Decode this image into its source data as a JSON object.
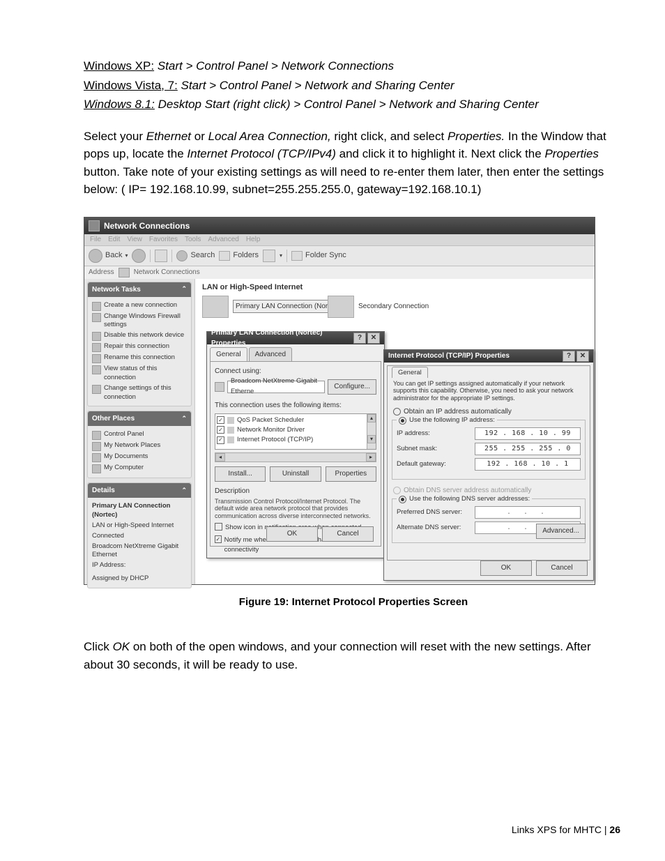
{
  "doc": {
    "os_lines": [
      {
        "os": "Windows XP:",
        "path": "Start > Control Panel  > Network Connections",
        "style": "ul"
      },
      {
        "os": "Windows Vista, 7:",
        "path": "Start > Control Panel > Network and Sharing Center",
        "style": "ul"
      },
      {
        "os": "Windows 8.1:",
        "path": "Desktop Start (right click) > Control Panel > Network and Sharing Center",
        "style": "ul-it"
      }
    ],
    "instr_main": "Select your Ethernet or Local Area Connection, right click, and select Properties.  In the Window that pops up, locate the Internet Protocol (TCP/IPv4) and click it to highlight it.  Next click the Properties button.  Take note of your existing settings as will need to re-enter them later, then enter the settings below: ( IP= 192.168.10.99,  subnet=255.255.255.0, gateway=192.168.10.1)",
    "instr_main_parts": {
      "p1a": "Select your ",
      "p1b": "Ethernet",
      "p1c": " or ",
      "p1d": "Local Area Connection,",
      "p1e": " right click, and select ",
      "p1f": "Properties.",
      "p1g": "  In the Window that pops up, locate the ",
      "p1h": "Internet Protocol (TCP/IPv4)",
      "p1i": " and click it to highlight it.  Next click the ",
      "p1j": "Properties",
      "p1k": " button.  Take note of your existing settings as will need to re-enter them later, then enter the settings below: ( IP= 192.168.10.99,  subnet=255.255.255.0, gateway=192.168.10.1)"
    },
    "caption": "Figure 19: Internet Protocol Properties Screen",
    "post_text_parts": {
      "a": "Click ",
      "b": "OK",
      "c": " on both of the open windows, and your connection will reset with the new settings. After about 30 seconds, it will be ready to use."
    },
    "footer": {
      "text": "Links XPS for MHTC | ",
      "page": "26"
    }
  },
  "ncwin": {
    "title": "Network Connections",
    "menus": [
      "File",
      "Edit",
      "View",
      "Favorites",
      "Tools",
      "Advanced",
      "Help"
    ],
    "toolbar": {
      "back": "Back",
      "search": "Search",
      "folders": "Folders",
      "foldersync": "Folder Sync"
    },
    "address_label": "Address",
    "address_value": "Network Connections",
    "group_label": "LAN or High-Speed Internet",
    "conn1": "Primary LAN Connection (Nortec)",
    "conn2": "Secondary Connection",
    "tasks": {
      "hdr": "Network Tasks",
      "items": [
        "Create a new connection",
        "Change Windows Firewall settings",
        "Disable this network device",
        "Repair this connection",
        "Rename this connection",
        "View status of this connection",
        "Change settings of this connection"
      ]
    },
    "other": {
      "hdr": "Other Places",
      "items": [
        "Control Panel",
        "My Network Places",
        "My Documents",
        "My Computer"
      ]
    },
    "details": {
      "hdr": "Details",
      "lines": [
        "Primary LAN Connection (Nortec)",
        "LAN or High-Speed Internet",
        "Connected",
        "Broadcom NetXtreme Gigabit Ethernet",
        "IP Address:",
        "Assigned by DHCP"
      ]
    }
  },
  "dlg1": {
    "title": "Primary LAN Connection (Nortec) Properties",
    "tabs": {
      "general": "General",
      "advanced": "Advanced"
    },
    "connect_using_label": "Connect using:",
    "adapter": "Broadcom NetXtreme Gigabit Etherne",
    "configure": "Configure...",
    "items_label": "This connection uses the following items:",
    "items": [
      "QoS Packet Scheduler",
      "Network Monitor Driver",
      "Internet Protocol (TCP/IP)"
    ],
    "buttons": {
      "install": "Install...",
      "uninstall": "Uninstall",
      "properties": "Properties"
    },
    "desc_label": "Description",
    "desc_text": "Transmission Control Protocol/Internet Protocol. The default wide area network protocol that provides communication across diverse interconnected networks.",
    "chk1": "Show icon in notification area when connected",
    "chk2": "Notify me when this connection has limited or no connectivity",
    "ok": "OK",
    "cancel": "Cancel"
  },
  "dlg2": {
    "title": "Internet Protocol (TCP/IP) Properties",
    "tab": "General",
    "hint": "You can get IP settings assigned automatically if your network supports this capability. Otherwise, you need to ask your network administrator for the appropriate IP settings.",
    "r_auto": "Obtain an IP address automatically",
    "r_manual": "Use the following IP address:",
    "ip_label": "IP address:",
    "ip": "192 . 168 .  10  .  99",
    "subnet_label": "Subnet mask:",
    "subnet": "255 . 255 . 255 .  0",
    "gw_label": "Default gateway:",
    "gw": "192 . 168 .  10  .   1",
    "dns_auto": "Obtain DNS server address automatically",
    "dns_manual": "Use the following DNS server addresses:",
    "pdns_label": "Preferred DNS server:",
    "adns_label": "Alternate DNS server:",
    "advanced": "Advanced...",
    "ok": "OK",
    "cancel": "Cancel"
  }
}
